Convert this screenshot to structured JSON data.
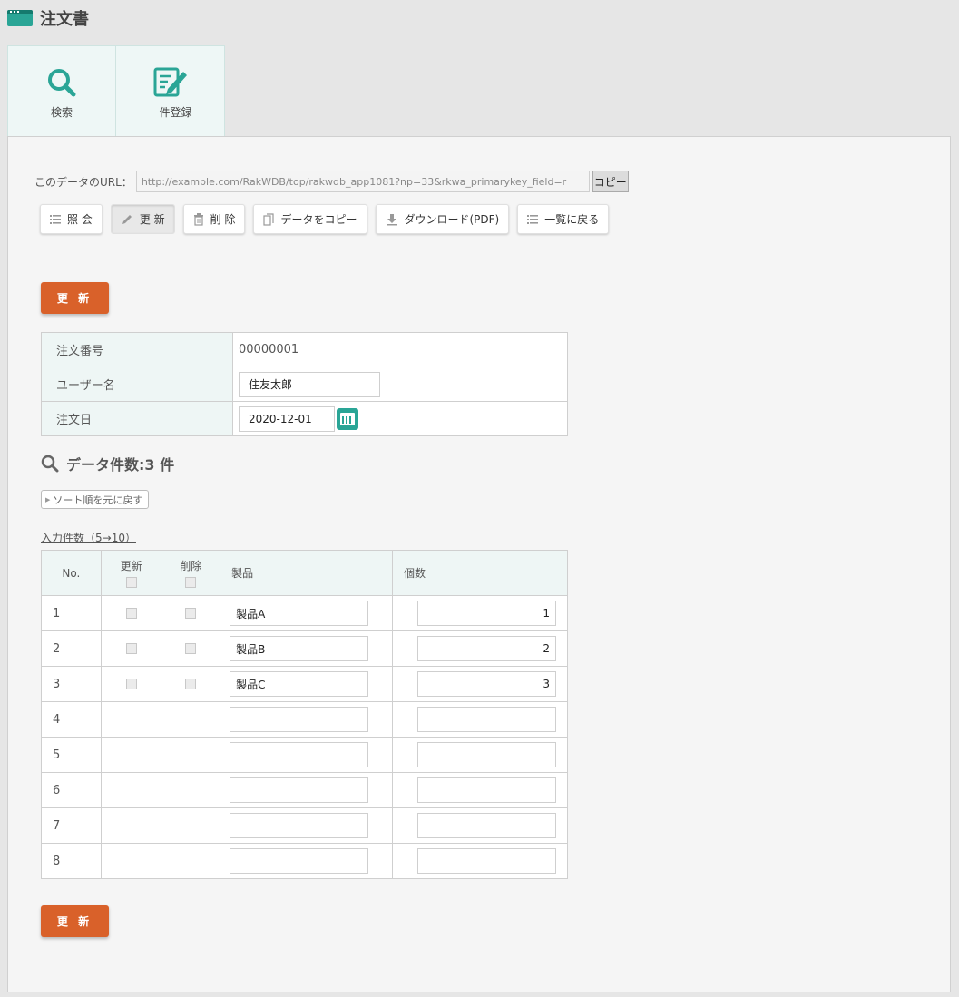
{
  "app": {
    "title": "注文書"
  },
  "tabs": [
    {
      "label": "検索",
      "icon": "search-icon"
    },
    {
      "label": "一件登録",
      "icon": "edit-icon"
    }
  ],
  "url": {
    "label": "このデータのURL：",
    "value": "http://example.com/RakWDB/top/rakwdb_app1081?np=33&rkwa_primarykey_field=r",
    "copy_label": "コピー"
  },
  "actions": [
    {
      "label": "照 会",
      "icon": "list-icon"
    },
    {
      "label": "更 新",
      "icon": "pencil-icon",
      "active": true
    },
    {
      "label": "削 除",
      "icon": "trash-icon"
    },
    {
      "label": "データをコピー",
      "icon": "copy-icon"
    },
    {
      "label": "ダウンロード(PDF)",
      "icon": "download-icon"
    },
    {
      "label": "一覧に戻る",
      "icon": "list-icon"
    }
  ],
  "update_label": "更 新",
  "form": {
    "order_no": {
      "label": "注文番号",
      "value": "00000001"
    },
    "user_name": {
      "label": "ユーザー名",
      "value": "住友太郎"
    },
    "order_date": {
      "label": "注文日",
      "value": "2020-12-01"
    }
  },
  "count": {
    "text": "データ件数:3 件"
  },
  "sort_reset_label": "ソート順を元に戻す",
  "input_count_label": "入力件数（5→10）",
  "detail": {
    "headers": {
      "no": "No.",
      "update": "更新",
      "delete": "削除",
      "product": "製品",
      "qty": "個数"
    },
    "rows": [
      {
        "no": "1",
        "product": "製品A",
        "qty": "1"
      },
      {
        "no": "2",
        "product": "製品B",
        "qty": "2"
      },
      {
        "no": "3",
        "product": "製品C",
        "qty": "3"
      },
      {
        "no": "4",
        "product": "",
        "qty": ""
      },
      {
        "no": "5",
        "product": "",
        "qty": ""
      },
      {
        "no": "6",
        "product": "",
        "qty": ""
      },
      {
        "no": "7",
        "product": "",
        "qty": ""
      },
      {
        "no": "8",
        "product": "",
        "qty": ""
      }
    ]
  },
  "colors": {
    "accent": "#2aa596",
    "primary_button": "#d9612a"
  }
}
